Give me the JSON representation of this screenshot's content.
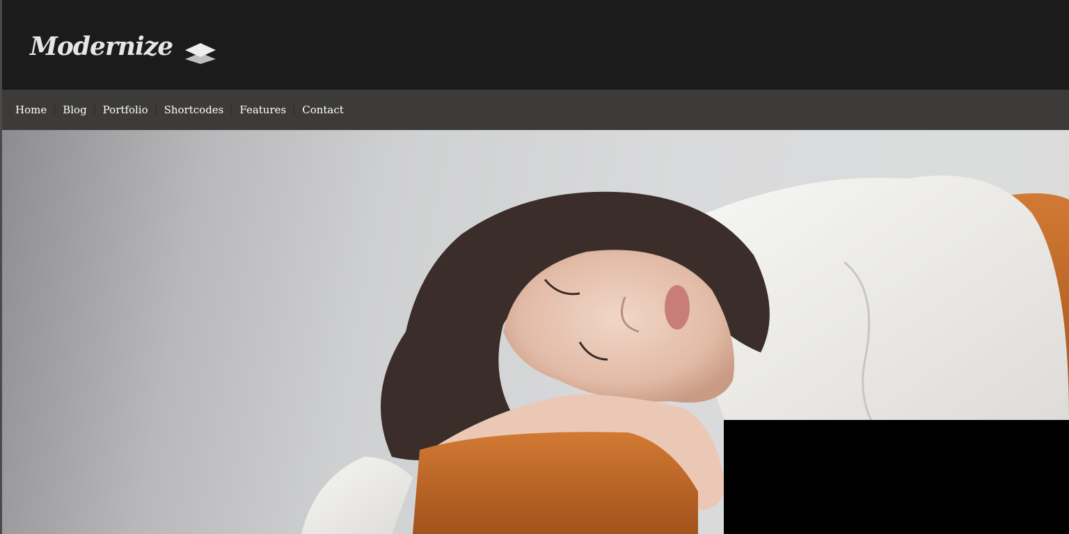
{
  "site": {
    "logo_text": "Modernize"
  },
  "nav": {
    "items": [
      {
        "label": "Home"
      },
      {
        "label": "Blog"
      },
      {
        "label": "Portfolio"
      },
      {
        "label": "Shortcodes"
      },
      {
        "label": "Features"
      },
      {
        "label": "Contact"
      }
    ]
  },
  "hero": {
    "image_subject": "woman-sleeping-on-sofa-arm-image"
  },
  "colors": {
    "header_bg": "#1b1b1b",
    "nav_bg": "#3c3b3a",
    "nav_text": "#ffffff",
    "logo_text": "#e6e6e6",
    "sofa": "#c0682a"
  }
}
